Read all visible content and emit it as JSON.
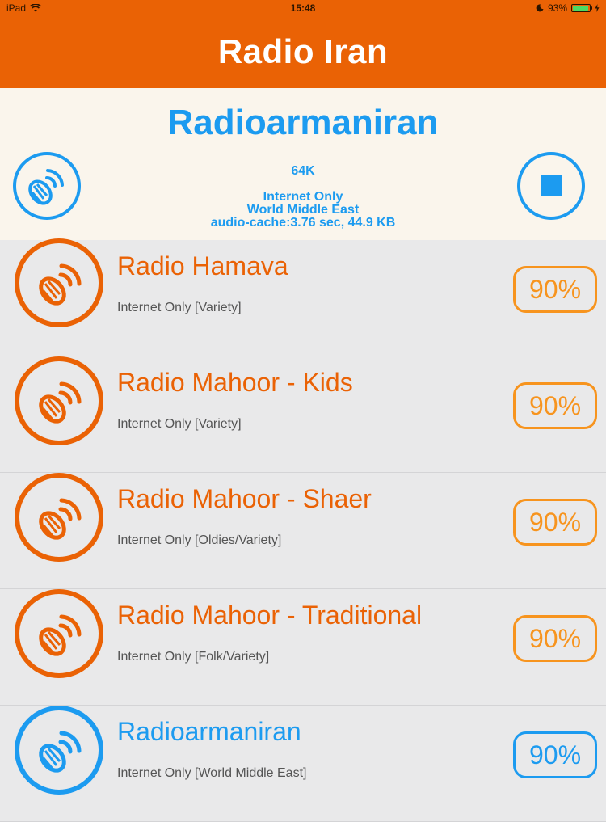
{
  "status_bar": {
    "device": "iPad",
    "time": "15:48",
    "battery_percent": "93%",
    "battery_level": 0.93
  },
  "nav": {
    "title": "Radio Iran"
  },
  "now_playing": {
    "name": "Radioarmaniran",
    "bitrate": "64K",
    "source": "Internet Only",
    "genre": "World Middle East",
    "cache": "audio-cache:3.76 sec, 44.9 KB"
  },
  "stations": [
    {
      "name": "Radio Hamava",
      "genre": "Internet Only [Variety]",
      "quality": "90%",
      "color": "#ea6205"
    },
    {
      "name": "Radio Mahoor - Kids",
      "genre": "Internet Only [Variety]",
      "quality": "90%",
      "color": "#ea6205"
    },
    {
      "name": "Radio Mahoor - Shaer",
      "genre": "Internet Only [Oldies/Variety]",
      "quality": "90%",
      "color": "#ea6205"
    },
    {
      "name": "Radio Mahoor - Traditional",
      "genre": "Internet Only [Folk/Variety]",
      "quality": "90%",
      "color": "#ea6205"
    },
    {
      "name": "Radioarmaniran",
      "genre": "Internet Only [World Middle East]",
      "quality": "90%",
      "color": "#1c9bf0"
    }
  ],
  "colors": {
    "accent": "#ea6205",
    "active": "#1c9bf0",
    "badge": "#f7941e"
  }
}
